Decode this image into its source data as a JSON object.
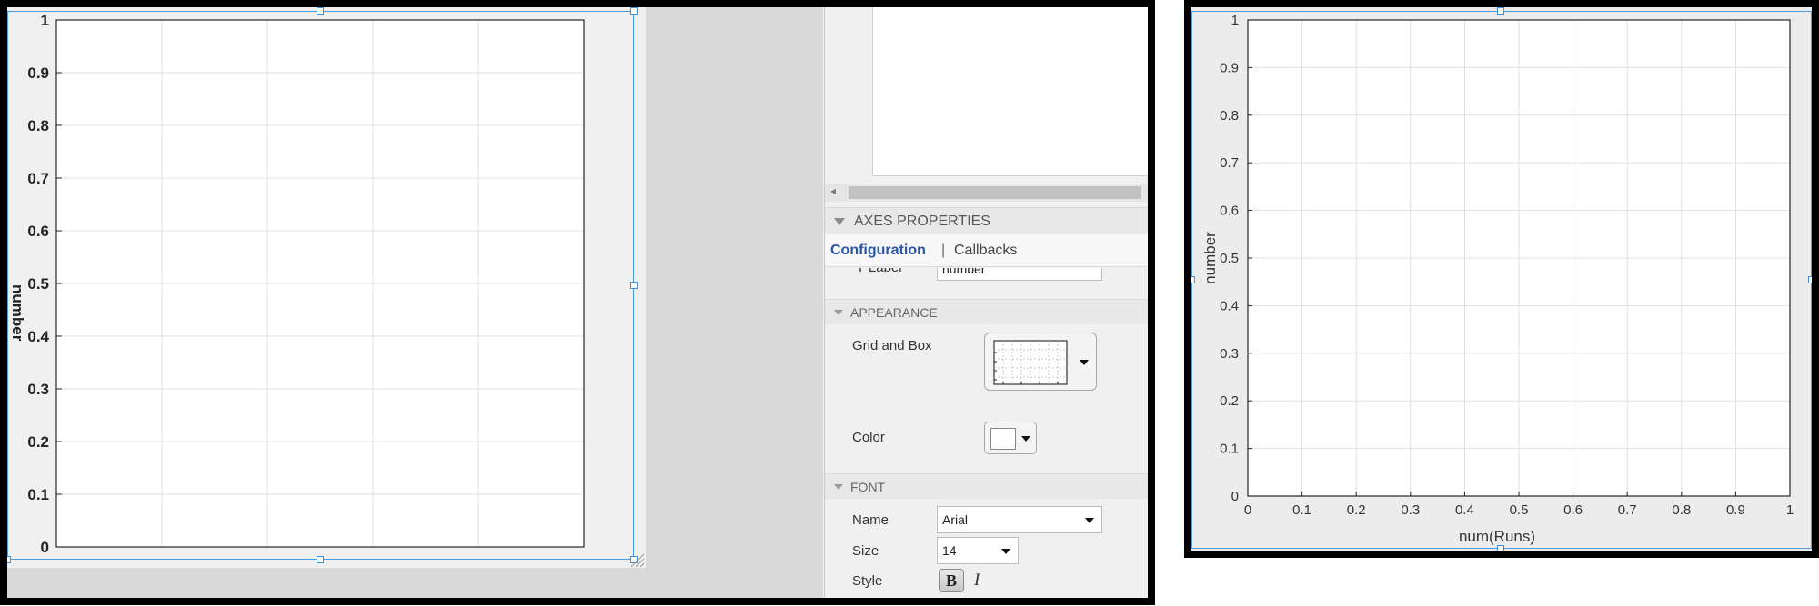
{
  "left_panel": {
    "axes": {
      "y_ticks": [
        "0",
        "0.1",
        "0.2",
        "0.3",
        "0.4",
        "0.5",
        "0.6",
        "0.7",
        "0.8",
        "0.9",
        "1"
      ],
      "ylabel": "number",
      "grid": true
    },
    "inspector": {
      "section_title": "AXES PROPERTIES",
      "tabs": {
        "configuration": "Configuration",
        "separator": "|",
        "callbacks": "Callbacks"
      },
      "partial_field": {
        "label": "Y Label",
        "value": "number"
      },
      "appearance": {
        "title": "APPEARANCE",
        "grid_and_box_label": "Grid and Box",
        "color_label": "Color",
        "color_value": "#ffffff"
      },
      "font": {
        "title": "FONT",
        "name_label": "Name",
        "name_value": "Arial",
        "size_label": "Size",
        "size_value": "14",
        "style_label": "Style",
        "bold": "B",
        "italic": "I"
      }
    }
  },
  "right_panel": {
    "axes": {
      "x_ticks": [
        "0",
        "0.1",
        "0.2",
        "0.3",
        "0.4",
        "0.5",
        "0.6",
        "0.7",
        "0.8",
        "0.9",
        "1"
      ],
      "y_ticks": [
        "0",
        "0.1",
        "0.2",
        "0.3",
        "0.4",
        "0.5",
        "0.6",
        "0.7",
        "0.8",
        "0.9",
        "1"
      ],
      "xlabel": "num(Runs)",
      "ylabel": "number",
      "grid": true
    }
  },
  "colors": {
    "selection": "#4a9be0",
    "tab_active": "#2b55a8",
    "grid": "#e0e0e0"
  }
}
